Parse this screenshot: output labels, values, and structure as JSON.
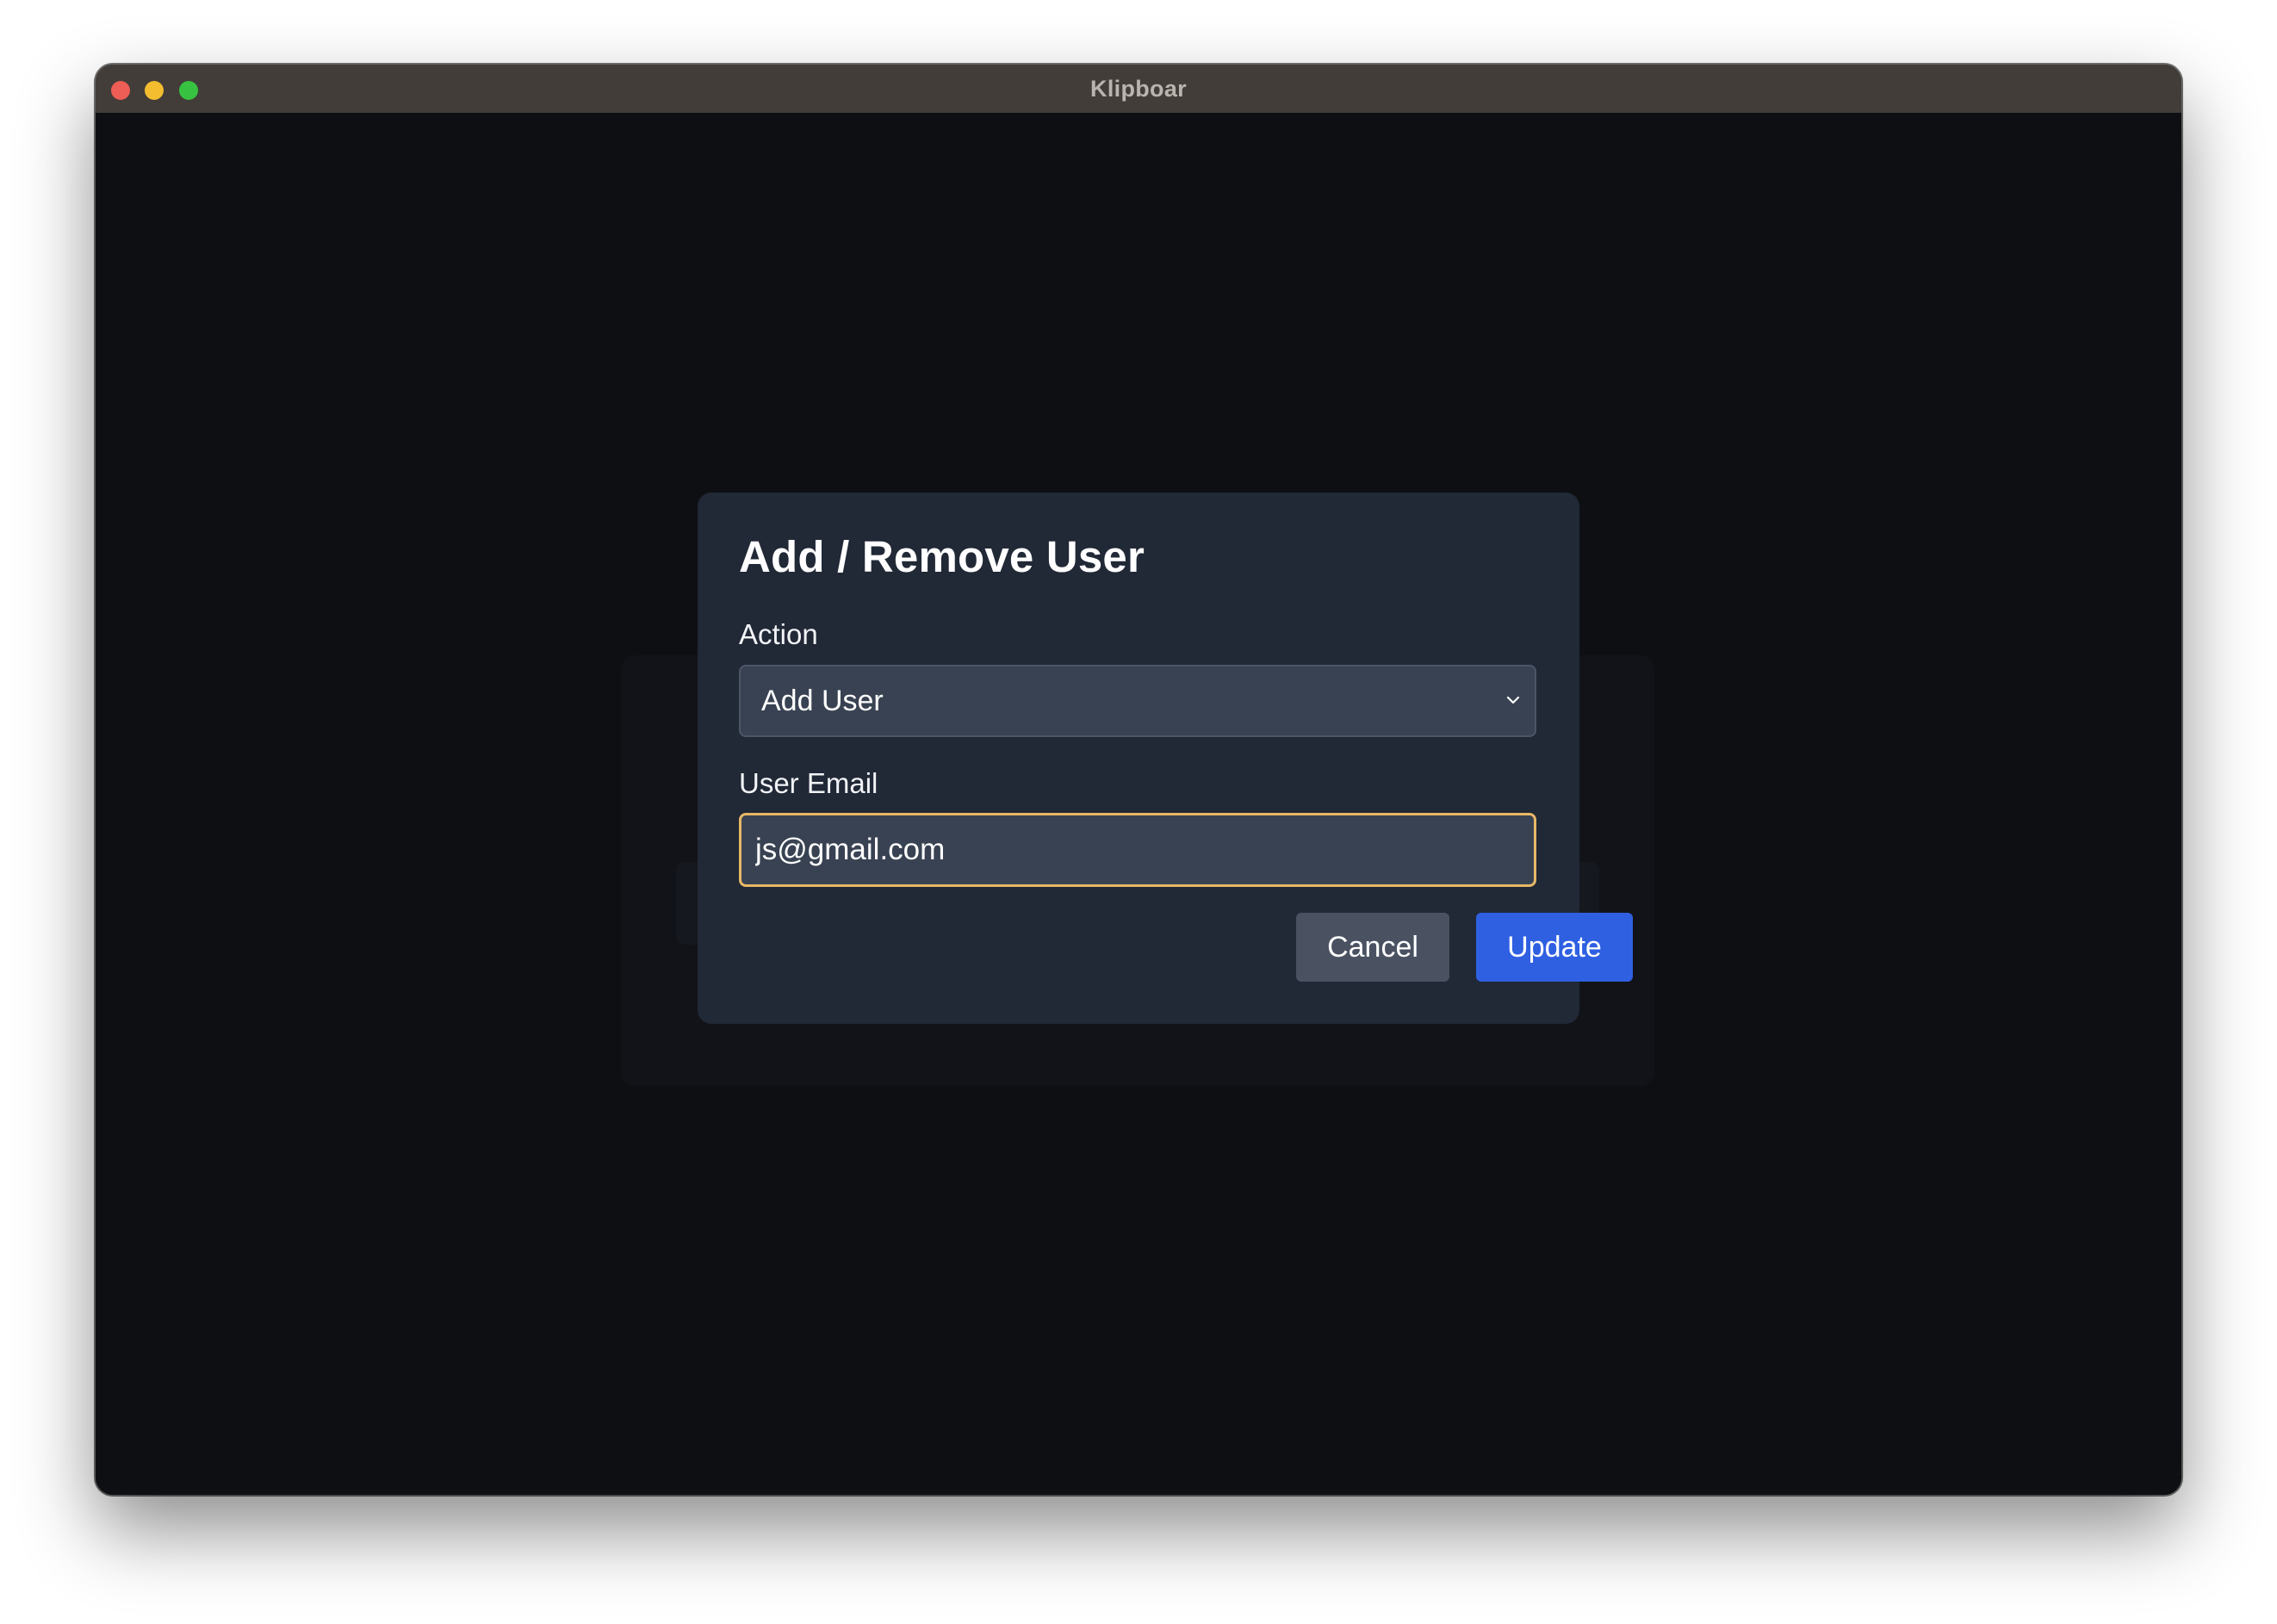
{
  "window": {
    "title": "Klipboar"
  },
  "dialog": {
    "title": "Add / Remove User",
    "action_label": "Action",
    "action_selected": "Add User",
    "email_label": "User Email",
    "email_value": "js@gmail.com",
    "cancel_label": "Cancel",
    "update_label": "Update"
  },
  "colors": {
    "accent": "#2f60e2",
    "focus_ring": "#e7b866",
    "dialog_bg": "#212836",
    "app_bg": "#0d0f13"
  }
}
